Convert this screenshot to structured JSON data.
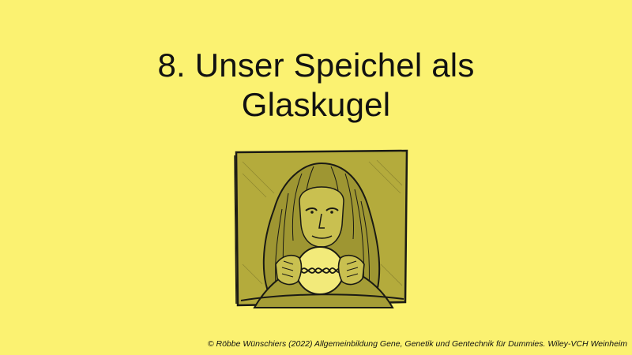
{
  "slide": {
    "title_line1": "8. Unser Speichel als",
    "title_line2": "Glaskugel",
    "credit": "© Röbbe Wünschiers (2022) Allgemeinbildung Gene, Genetik und Gentechnik für Dummies. Wiley-VCH Weinheim",
    "illustration_subject": "fortune-teller-with-crystal-ball",
    "colors": {
      "background": "#fbf271",
      "illustration_fill": "#b4ab3c",
      "ball": "#f2ea7a",
      "ink": "#1a1a14"
    }
  }
}
